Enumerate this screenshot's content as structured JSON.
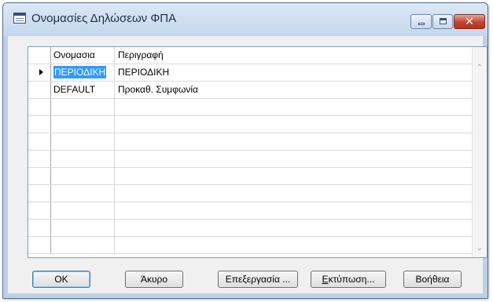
{
  "window": {
    "title": "Ονομασίες Δηλώσεων ΦΠΑ",
    "close_glyph": "✕"
  },
  "grid": {
    "columns": [
      "Ονομασια",
      "Περιγραφή"
    ],
    "rows": [
      {
        "name": "ΠΕΡΙΟΔΙΚΗ",
        "description": "ΠΕΡΙΟΔΙΚΗ",
        "current": true,
        "name_selected": true
      },
      {
        "name": "DEFAULT",
        "description": "Προκαθ. Συμφωνία",
        "current": false,
        "name_selected": false
      }
    ],
    "empty_row_count": 9
  },
  "scrollbar": {
    "up_glyph": "⌃",
    "down_glyph": "⌄"
  },
  "buttons": {
    "ok": "OK",
    "cancel": "Άκυρο",
    "edit": "Επεξεργασία ...",
    "print_underlined": "Ε",
    "print_rest": "κτύπωση...",
    "help": "Βοήθεια"
  },
  "colors": {
    "selection": "#3399ff",
    "window_frame": "#bcd0e8",
    "close_button": "#c4432f"
  }
}
